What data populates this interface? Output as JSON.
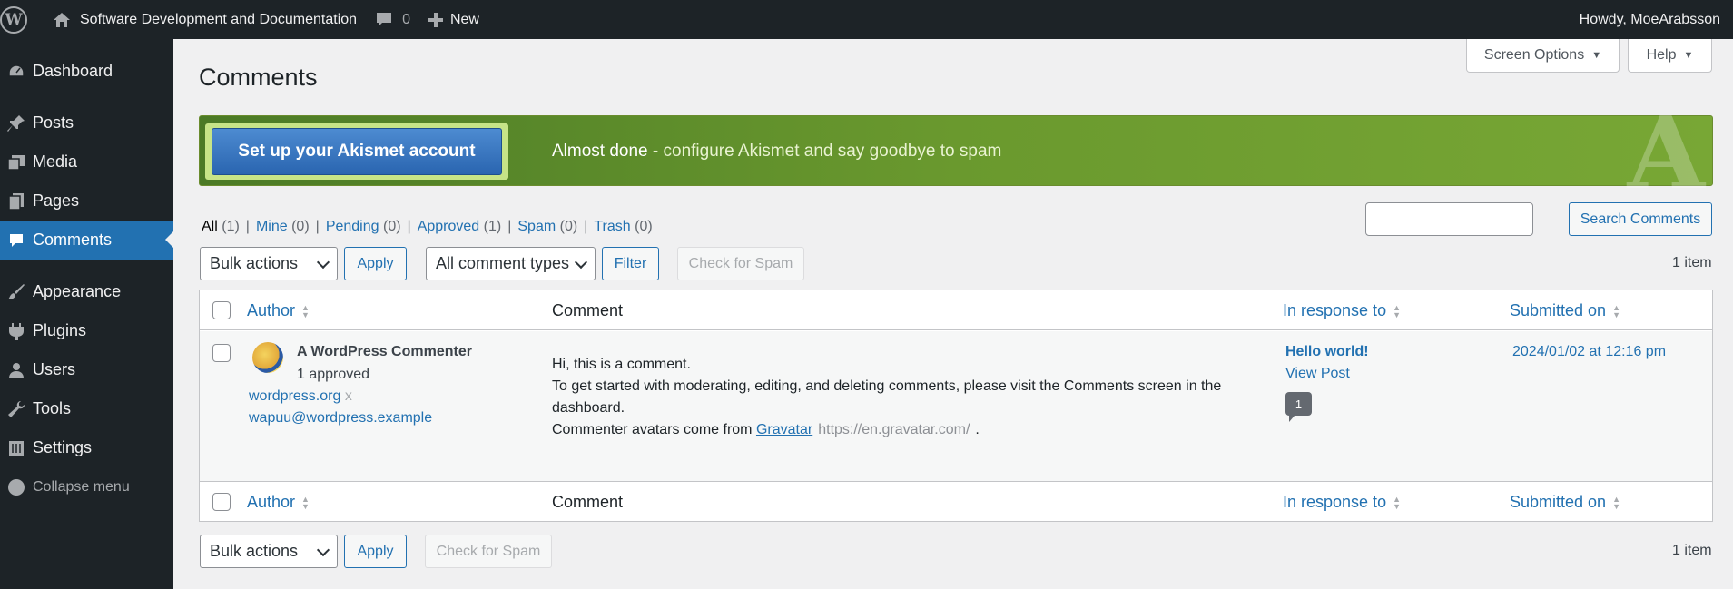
{
  "admin_bar": {
    "site_name": "Software Development and Documentation",
    "comments_count": "0",
    "new_label": "New",
    "greeting": "Howdy, MoeArabsson"
  },
  "sidebar": {
    "items": [
      {
        "label": "Dashboard",
        "icon": "dashboard-icon"
      },
      {
        "label": "Posts",
        "icon": "pin-icon"
      },
      {
        "label": "Media",
        "icon": "media-icon"
      },
      {
        "label": "Pages",
        "icon": "pages-icon"
      },
      {
        "label": "Comments",
        "icon": "comment-icon"
      },
      {
        "label": "Appearance",
        "icon": "brush-icon"
      },
      {
        "label": "Plugins",
        "icon": "plug-icon"
      },
      {
        "label": "Users",
        "icon": "user-icon"
      },
      {
        "label": "Tools",
        "icon": "wrench-icon"
      },
      {
        "label": "Settings",
        "icon": "settings-icon"
      }
    ],
    "collapse_label": "Collapse menu",
    "current": "Comments"
  },
  "header": {
    "title": "Comments",
    "screen_options": "Screen Options",
    "help": "Help"
  },
  "akismet": {
    "button": "Set up your Akismet account",
    "text_strong": "Almost done",
    "text_rest": " - configure Akismet and say goodbye to spam",
    "logo_letter": "A"
  },
  "filters": {
    "all": "All",
    "all_count": "(1)",
    "mine": "Mine",
    "mine_count": "(0)",
    "pending": "Pending",
    "pending_count": "(0)",
    "approved": "Approved",
    "approved_count": "(1)",
    "spam": "Spam",
    "spam_count": "(0)",
    "trash": "Trash",
    "trash_count": "(0)"
  },
  "search": {
    "button": "Search Comments",
    "value": ""
  },
  "tablenav_top": {
    "bulk_actions": "Bulk actions",
    "apply": "Apply",
    "comment_types": "All comment types",
    "filter": "Filter",
    "check_spam": "Check for Spam",
    "items": "1 item"
  },
  "table": {
    "columns": [
      "Author",
      "Comment",
      "In response to",
      "Submitted on"
    ],
    "row": {
      "author_name": "A WordPress Commenter",
      "author_approved": "1 approved",
      "author_url": "wordpress.org",
      "author_url_suffix": "x",
      "author_email": "wapuu@wordpress.example",
      "comment_line1": "Hi, this is a comment.",
      "comment_line2": "To get started with moderating, editing, and deleting comments, please visit the Comments screen in the dashboard.",
      "comment_line3_prefix": "Commenter avatars come from",
      "comment_link": "Gravatar",
      "comment_url": "https://en.gravatar.com/",
      "comment_end": ".",
      "response_title": "Hello world!",
      "view_post": "View Post",
      "comment_bubble": "1",
      "submitted": "2024/01/02 at 12:16 pm"
    }
  },
  "tablenav_bottom": {
    "bulk_actions": "Bulk actions",
    "apply": "Apply",
    "check_spam": "Check for Spam",
    "items": "1 item"
  }
}
